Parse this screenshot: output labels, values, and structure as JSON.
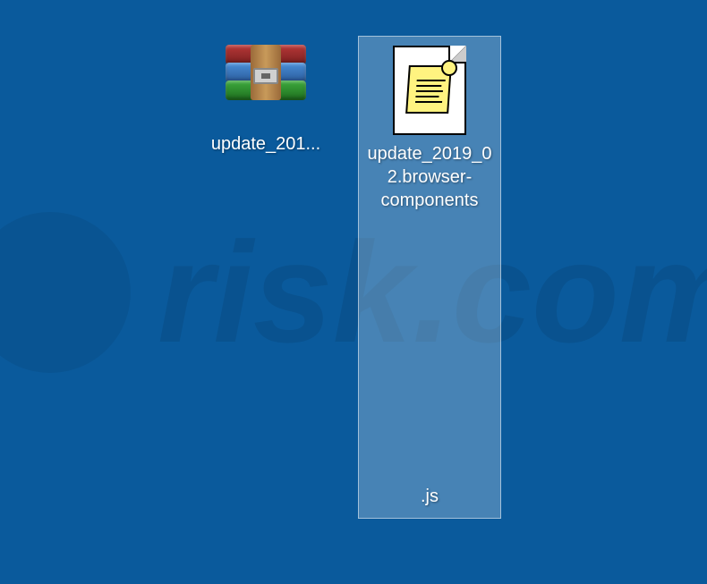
{
  "desktop": {
    "files": [
      {
        "label": "update_201...",
        "type": "rar"
      },
      {
        "label": "update_2019_02.browser-components",
        "extension": ".js",
        "type": "js",
        "selected": true
      }
    ]
  },
  "watermark": {
    "text": "risk.com"
  }
}
